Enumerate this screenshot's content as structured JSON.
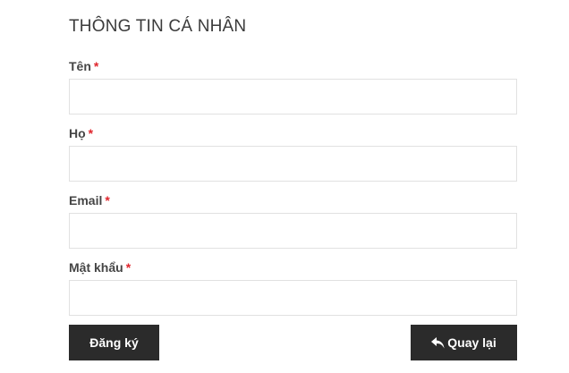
{
  "form": {
    "title": "THÔNG TIN CÁ NHÂN",
    "required_marker": "*",
    "fields": [
      {
        "label": "Tên",
        "value": "",
        "placeholder": ""
      },
      {
        "label": "Họ",
        "value": "",
        "placeholder": ""
      },
      {
        "label": "Email",
        "value": "",
        "placeholder": ""
      },
      {
        "label": "Mật khẩu",
        "value": "",
        "placeholder": ""
      }
    ]
  },
  "actions": {
    "register_label": "Đăng ký",
    "back_label": "Quay lại",
    "back_icon": "reply-arrow-icon"
  },
  "colors": {
    "required": "#e0262d",
    "button_bg": "#2b2b2b",
    "button_text": "#ffffff",
    "input_border": "#e1e1e1"
  }
}
